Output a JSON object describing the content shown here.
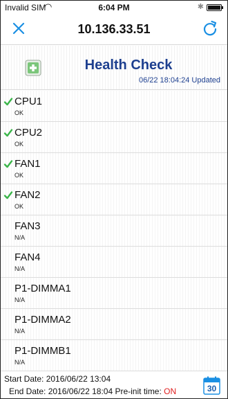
{
  "status_bar": {
    "carrier": "Invalid SIM",
    "time": "6:04 PM"
  },
  "nav": {
    "title": "10.136.33.51",
    "close_icon": "close-icon",
    "refresh_icon": "refresh-icon",
    "accent_color": "#1a8fe3"
  },
  "header": {
    "title": "Health Check",
    "updated": "06/22 18:04:24 Updated",
    "title_color": "#1d3f8f"
  },
  "items": [
    {
      "name": "CPU1",
      "status": "OK",
      "checked": true
    },
    {
      "name": "CPU2",
      "status": "OK",
      "checked": true
    },
    {
      "name": "FAN1",
      "status": "OK",
      "checked": true
    },
    {
      "name": "FAN2",
      "status": "OK",
      "checked": true
    },
    {
      "name": "FAN3",
      "status": "N/A",
      "checked": false
    },
    {
      "name": "FAN4",
      "status": "N/A",
      "checked": false
    },
    {
      "name": "P1-DIMMA1",
      "status": "N/A",
      "checked": false
    },
    {
      "name": "P1-DIMMA2",
      "status": "N/A",
      "checked": false
    },
    {
      "name": "P1-DIMMB1",
      "status": "N/A",
      "checked": false
    }
  ],
  "footer": {
    "start_date": "Start Date: 2016/06/22 13:04",
    "end_date": "End Date: 2016/06/22 18:04",
    "preinit_label": "Pre-init time:",
    "preinit_value": "ON",
    "calendar_day": "30"
  },
  "colors": {
    "check": "#3bb54a",
    "on": "#e02020"
  }
}
